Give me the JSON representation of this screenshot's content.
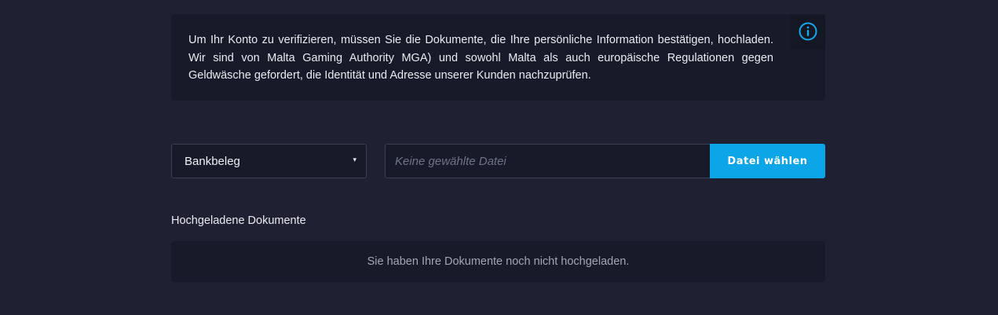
{
  "info": {
    "text": "Um Ihr Konto zu verifizieren, müssen Sie die Dokumente, die Ihre persönliche Information bestätigen, hochladen. Wir sind von Malta Gaming Authority MGA) und sowohl Malta als auch europäische Regulationen gegen Geldwäsche gefordert, die Identität und Adresse unserer Kunden nachzuprüfen.",
    "icon": "info-circle-icon",
    "icon_color": "#1aa7ec"
  },
  "document_type": {
    "selected": "Bankbeleg",
    "caret": "▾"
  },
  "file_upload": {
    "placeholder": "Keine gewählte Datei",
    "button_label": "Datei wählen",
    "button_color": "#0ba5e8"
  },
  "uploaded": {
    "title": "Hochgeladene Dokumente",
    "empty_message": "Sie haben Ihre Dokumente noch nicht hochgeladen."
  },
  "colors": {
    "background": "#1f2132",
    "panel": "#171a29"
  }
}
